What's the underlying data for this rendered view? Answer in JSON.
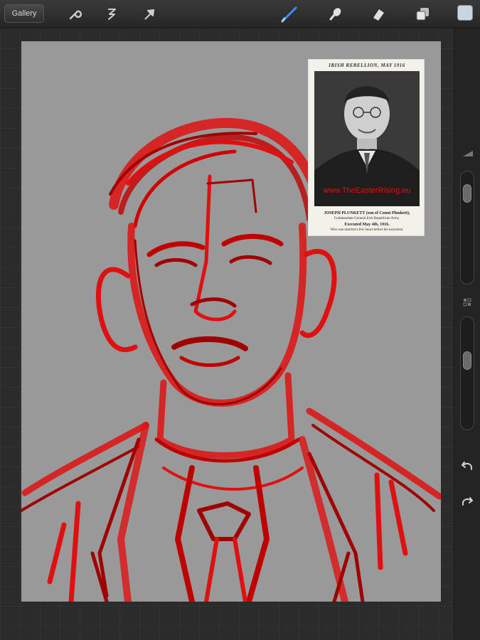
{
  "toolbar": {
    "gallery_label": "Gallery",
    "tools": [
      {
        "icon": "wrench-icon",
        "name": "actions"
      },
      {
        "icon": "adjustments-icon",
        "name": "adjustments"
      },
      {
        "icon": "cursor-arrow-icon",
        "name": "selection"
      },
      {
        "icon": "brush-icon",
        "name": "paint",
        "active": true
      },
      {
        "icon": "smudge-icon",
        "name": "smudge"
      },
      {
        "icon": "eraser-icon",
        "name": "eraser"
      },
      {
        "icon": "layers-icon",
        "name": "layers"
      }
    ],
    "current_color": "#c8d6e0"
  },
  "colors": {
    "accent_brush": "#3a8dff",
    "sketch_red": "#e01010",
    "sketch_dark_red": "#a00000",
    "canvas": "#999999"
  },
  "reference": {
    "header": "IRISH REBELLION, MAY 1916",
    "watermark": "www.TheEasterRising.eu",
    "caption_line1": "JOSEPH PLUNKETT (son of Count Plunkett),",
    "caption_line2": "Commandant-General Irish Republican Army.",
    "caption_line3": "Executed May 4th, 1916.",
    "caption_line4": "Who was married a few hours before his execution."
  },
  "sidebar": {
    "brush_size_level": 0.12,
    "opacity_level": 0.35,
    "undo_icon": "undo-icon",
    "redo_icon": "redo-icon"
  }
}
